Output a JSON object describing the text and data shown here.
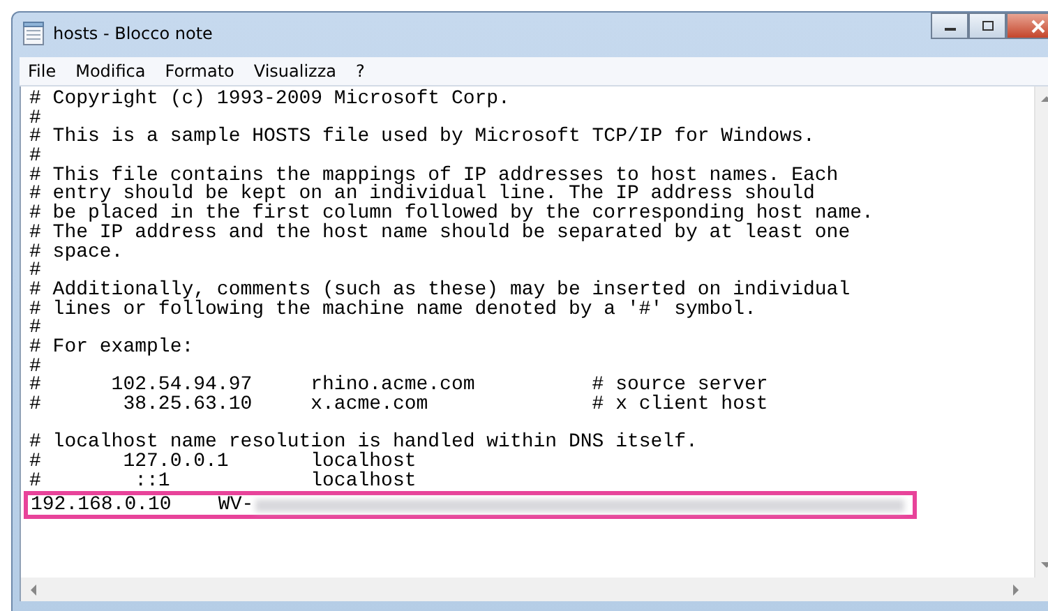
{
  "window": {
    "title": "hosts - Blocco note"
  },
  "menu": [
    "File",
    "Modifica",
    "Formato",
    "Visualizza",
    "?"
  ],
  "editor": {
    "blocks": [
      [
        "# Copyright (c) 1993-2009 Microsoft Corp.",
        "#",
        "# This is a sample HOSTS file used by Microsoft TCP/IP for Windows.",
        "#",
        "# This file contains the mappings of IP addresses to host names. Each",
        "# entry should be kept on an individual line. The IP address should",
        "# be placed in the first column followed by the corresponding host name.",
        "# The IP address and the host name should be separated by at least one",
        "# space.",
        "#",
        "# Additionally, comments (such as these) may be inserted on individual",
        "# lines or following the machine name denoted by a '#' symbol.",
        "#",
        "# For example:",
        "#",
        "#      102.54.94.97     rhino.acme.com          # source server",
        "#       38.25.63.10     x.acme.com              # x client host"
      ],
      [
        "# localhost name resolution is handled within DNS itself.",
        "#       127.0.0.1       localhost",
        "#        ::1            localhost"
      ]
    ],
    "highlighted_line": {
      "text": "192.168.0.10    WV-",
      "obscured": true
    }
  }
}
